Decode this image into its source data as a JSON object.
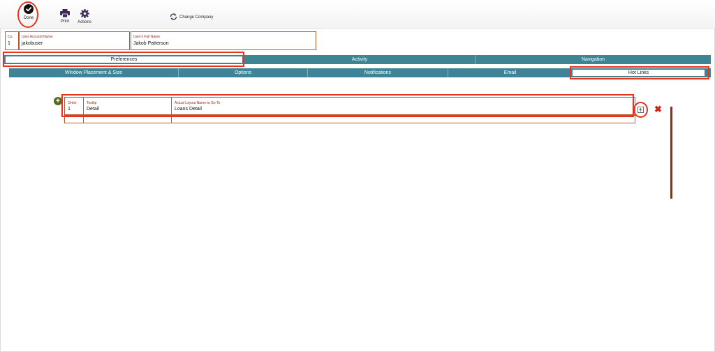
{
  "toolbar": {
    "done_label": "Done",
    "print_label": "Print",
    "actions_label": "Actions",
    "change_company_label": "Change Company"
  },
  "header_fields": {
    "company": {
      "label": "Co.",
      "value": "1"
    },
    "account_name": {
      "label": "User Account Name",
      "value": "jakobuser"
    },
    "full_name": {
      "label": "User's Full Name",
      "value": "Jakob Patterson"
    }
  },
  "main_tabs": [
    {
      "label": "Preferences",
      "active": true
    },
    {
      "label": "Activity",
      "active": false
    },
    {
      "label": "Navigation",
      "active": false
    }
  ],
  "sub_tabs": [
    {
      "label": "Window Placement & Size",
      "active": false
    },
    {
      "label": "Options",
      "active": false
    },
    {
      "label": "Notifications",
      "active": false
    },
    {
      "label": "Email",
      "active": false
    },
    {
      "label": "Hot Links",
      "active": true
    }
  ],
  "hot_links": {
    "columns": [
      "Order",
      "Tooltip",
      "Actual Layout Name to Go To"
    ],
    "rows": [
      {
        "order": "1",
        "tooltip": "Detail",
        "layout_name": "Loans Detail"
      },
      {
        "order": "",
        "tooltip": "",
        "layout_name": ""
      }
    ]
  },
  "colors": {
    "tab_bar": "#3d8494",
    "field_border": "#b5582d",
    "field_label": "#a12b1a",
    "annotation": "#e8321c",
    "delete": "#d2221a",
    "add": "#566b1b"
  }
}
